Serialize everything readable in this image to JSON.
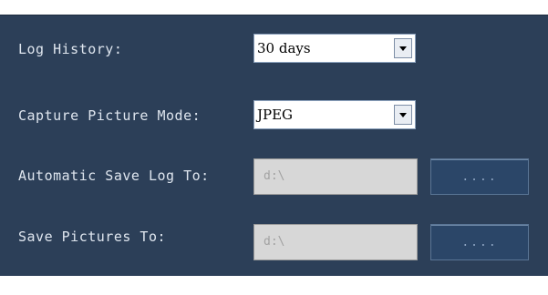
{
  "settings": {
    "log_history": {
      "label": "Log History:",
      "value": "30 days"
    },
    "capture_mode": {
      "label": "Capture Picture Mode:",
      "value": "JPEG"
    },
    "auto_save_log": {
      "label": "Automatic Save Log To:",
      "value": "d:\\",
      "button": "...."
    },
    "save_pictures": {
      "label": "Save Pictures To:",
      "value": "d:\\",
      "button": "...."
    }
  }
}
